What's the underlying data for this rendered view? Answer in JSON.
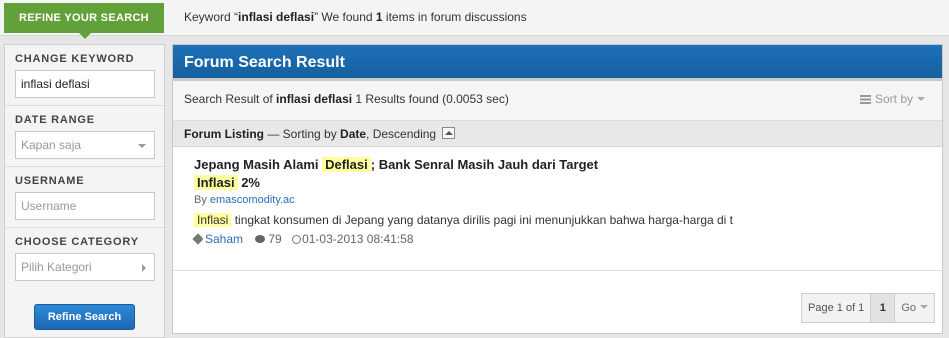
{
  "topbar": {
    "refine_tab": "REFINE YOUR SEARCH",
    "summary_prefix": "Keyword “",
    "keyword": "inflasi deflasi",
    "summary_mid": "” We found ",
    "count": "1",
    "summary_suffix": " items in forum discussions"
  },
  "sidebar": {
    "keyword_label": "CHANGE KEYWORD",
    "keyword_value": "inflasi deflasi",
    "date_label": "DATE RANGE",
    "date_value": "Kapan saja",
    "username_label": "USERNAME",
    "username_placeholder": "Username",
    "category_label": "CHOOSE CATEGORY",
    "category_value": "Pilih Kategori",
    "refine_button": "Refine Search"
  },
  "main": {
    "header": "Forum Search Result",
    "result_prefix": "Search Result of ",
    "result_keyword": "inflasi deflasi",
    "result_suffix": " 1 Results found (0.0053 sec)",
    "sort_by": "Sort by",
    "listing_label": "Forum Listing",
    "listing_sep": " — Sorting by ",
    "listing_sort_field": "Date",
    "listing_sort_order": ", Descending"
  },
  "post": {
    "title_part1": "Jepang Masih Alami ",
    "title_hl1": "Deflasi",
    "title_part2": "; Bank Senral Masih Jauh dari Target ",
    "title_hl2": "Inflasi",
    "title_part3": " 2%",
    "by_label": "By ",
    "author": "emascomodity.ac",
    "snippet_hl": "Inflasi",
    "snippet_rest": " tingkat konsumen di Jepang yang datanya dirilis pagi ini menunjukkan bahwa harga-harga di t",
    "category": "Saham",
    "comments": "79",
    "date": "01-03-2013 08:41:58"
  },
  "pager": {
    "info": "Page 1 of 1",
    "current": "1",
    "go": "Go"
  }
}
